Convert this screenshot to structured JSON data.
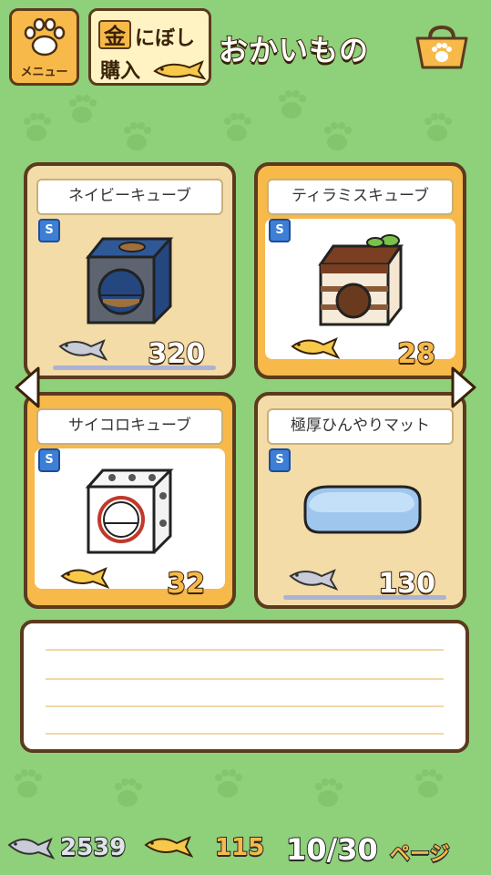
{
  "header": {
    "menu_label": "メニュー",
    "gold_char": "金",
    "buy_line1": "にぼし",
    "buy_line2": "購入",
    "title": "おかいもの"
  },
  "items": [
    {
      "name": "ネイビーキューブ",
      "badge": "S",
      "price": "320",
      "currency": "silver-niboshi",
      "card_color": "#f3dca8"
    },
    {
      "name": "ティラミスキューブ",
      "badge": "S",
      "price": "28",
      "currency": "gold-niboshi",
      "card_color": "#f6b94a"
    },
    {
      "name": "サイコロキューブ",
      "badge": "S",
      "price": "32",
      "currency": "gold-niboshi",
      "card_color": "#f6b94a"
    },
    {
      "name": "極厚ひんやりマット",
      "badge": "S",
      "price": "130",
      "currency": "silver-niboshi",
      "card_color": "#f3dca8"
    }
  ],
  "description": {
    "text": ""
  },
  "footer": {
    "silver_count": "2539",
    "gold_count": "115",
    "page": "10/30",
    "page_label": "ページ"
  },
  "colors": {
    "background": "#8fd07a",
    "accent": "#f6b94a",
    "outline": "#5a3b1e"
  }
}
